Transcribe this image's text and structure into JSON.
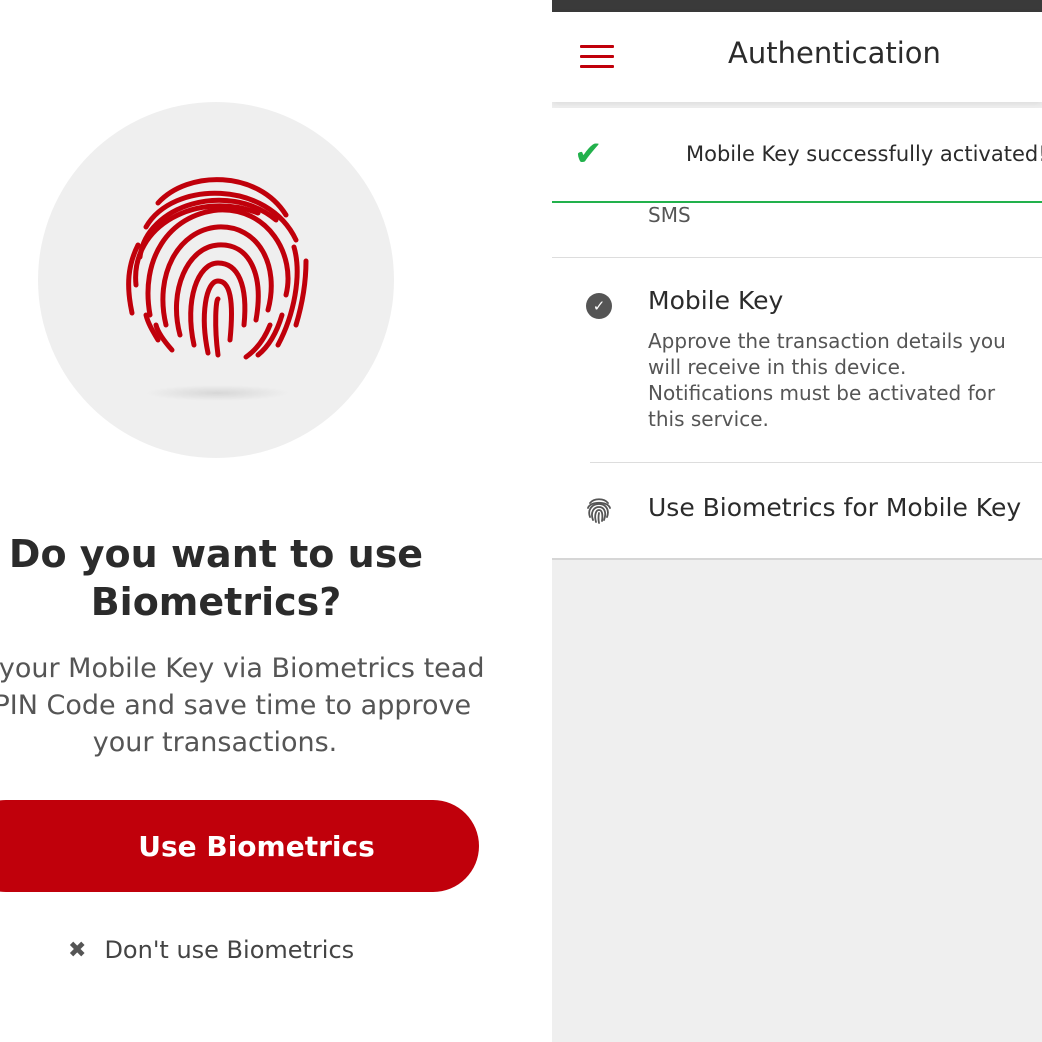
{
  "left_screen": {
    "icon": "fingerprint-icon",
    "headline": "Do you want to use Biometrics?",
    "description": "ess your Mobile Key via Biometrics tead of PIN Code and save time to approve your transactions.",
    "primary_button": "Use Biometrics",
    "secondary_icon": "close-icon",
    "secondary_link": "Don't use Biometrics"
  },
  "right_screen": {
    "menu_icon": "hamburger-menu-icon",
    "title": "Authentication",
    "toast": {
      "icon": "checkmark-icon",
      "message": "Mobile Key successfully activated!"
    },
    "options": [
      {
        "label": "SMS"
      },
      {
        "icon": "check-circle-icon",
        "title": "Mobile Key",
        "description": "Approve the transaction details you will receive in this device. Notifications must be activated for this service."
      },
      {
        "icon": "fingerprint-icon",
        "title": "Use Biometrics for Mobile Key"
      }
    ]
  },
  "colors": {
    "brand_red": "#c0000b",
    "success_green": "#22b14c",
    "text_dark": "#2b2b2b",
    "text_muted": "#555555",
    "background_gray": "#efefef"
  }
}
